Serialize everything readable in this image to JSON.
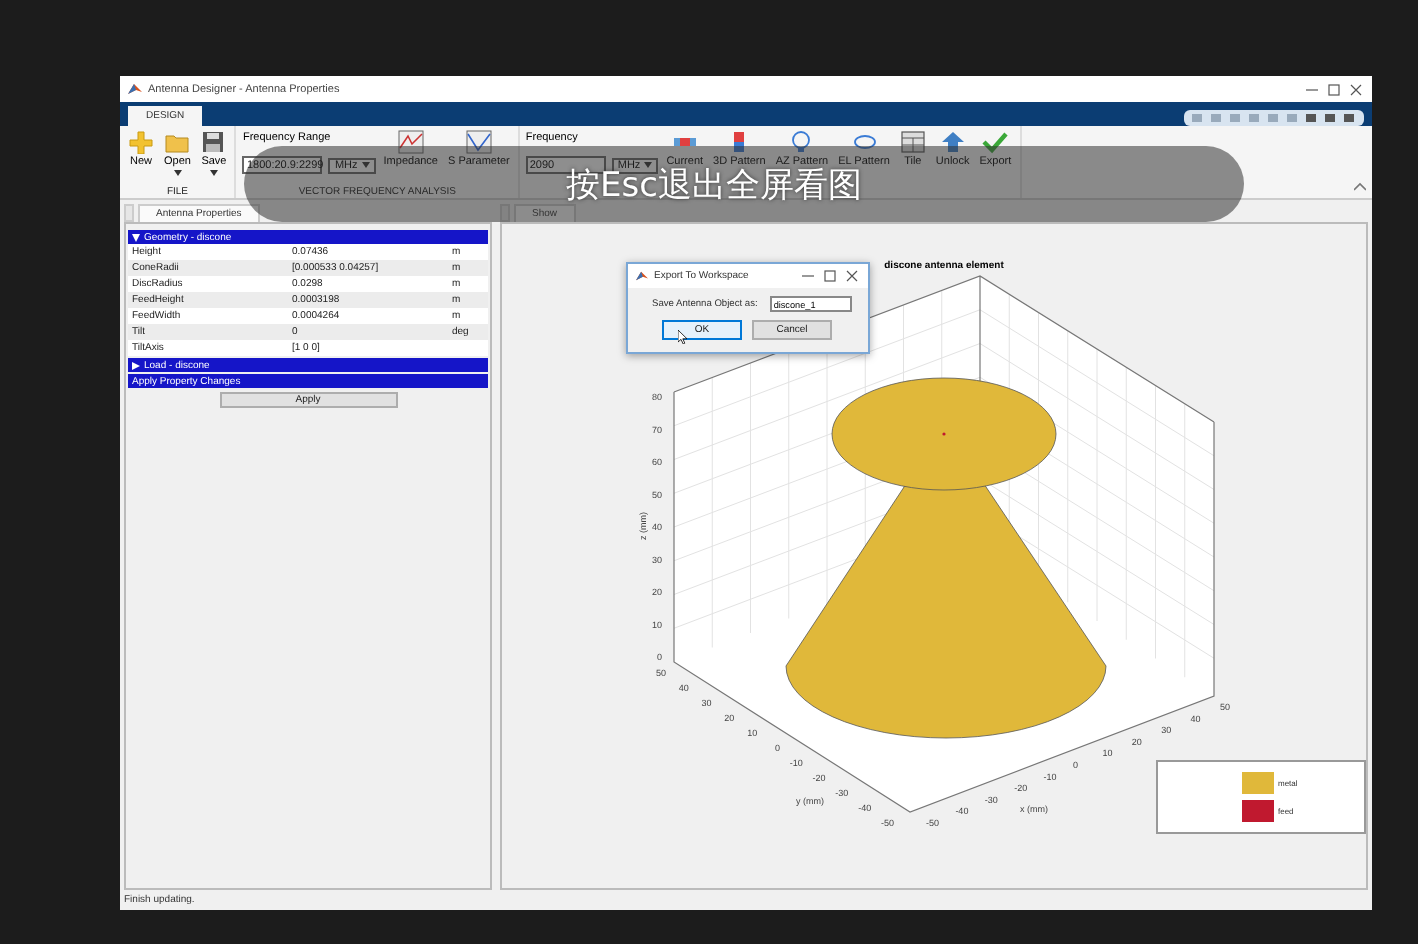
{
  "window": {
    "title": "Antenna Designer - Antenna Properties"
  },
  "ribbon": {
    "tabs": [
      {
        "label": "DESIGN",
        "selected": true
      }
    ],
    "groups": [
      {
        "label": "FILE",
        "buttons": [
          {
            "label": "New",
            "dropdown": false
          },
          {
            "label": "Open",
            "dropdown": true
          },
          {
            "label": "Save",
            "dropdown": true
          }
        ]
      },
      {
        "label": "VECTOR FREQUENCY ANALYSIS",
        "fields": [
          {
            "label": "Frequency Range",
            "value": "1800:20.9:2299",
            "unit": "MHz"
          }
        ],
        "buttons": [
          {
            "label": "Impedance",
            "dropdown": false
          },
          {
            "label": "S Parameter",
            "dropdown": false
          }
        ]
      },
      {
        "fields": [
          {
            "label": "Frequency",
            "value": "2090",
            "unit": "MHz"
          }
        ],
        "buttons": [
          {
            "label": "Current",
            "dropdown": false
          },
          {
            "label": "3D Pattern",
            "dropdown": false
          },
          {
            "label": "AZ Pattern",
            "dropdown": false
          },
          {
            "label": "EL Pattern",
            "dropdown": false
          },
          {
            "label": "Tile",
            "dropdown": false
          },
          {
            "label": "Unlock",
            "dropdown": false
          },
          {
            "label": "Export",
            "dropdown": false
          }
        ]
      }
    ]
  },
  "properties_panel": {
    "tab": "Antenna Properties",
    "sections": [
      {
        "title": "Geometry - discone",
        "expanded": true,
        "rows": [
          {
            "name": "Height",
            "value": "0.07436",
            "unit": "m"
          },
          {
            "name": "ConeRadii",
            "value": "[0.000533 0.04257]",
            "unit": "m"
          },
          {
            "name": "DiscRadius",
            "value": "0.0298",
            "unit": "m"
          },
          {
            "name": "FeedHeight",
            "value": "0.0003198",
            "unit": "m"
          },
          {
            "name": "FeedWidth",
            "value": "0.0004264",
            "unit": "m"
          },
          {
            "name": "Tilt",
            "value": "0",
            "unit": "deg"
          },
          {
            "name": "TiltAxis",
            "value": "[1 0 0]"
          }
        ]
      },
      {
        "title": "Load - discone",
        "expanded": false
      }
    ],
    "apply_header": "Apply Property Changes",
    "apply_button": "Apply"
  },
  "show_panel": {
    "tab": "Show"
  },
  "plot": {
    "title": "discone antenna element",
    "z_label": "z (mm)",
    "y_label": "y (mm)",
    "x_label": "x (mm)",
    "z_ticks": [
      "80",
      "70",
      "60",
      "50",
      "40",
      "30",
      "20",
      "10",
      "0"
    ],
    "y_ticks": [
      "50",
      "40",
      "30",
      "20",
      "10",
      "0",
      "-10",
      "-20",
      "-30",
      "-40",
      "-50"
    ],
    "x_ticks": [
      "-50",
      "-40",
      "-30",
      "-20",
      "-10",
      "0",
      "10",
      "20",
      "30",
      "40",
      "50"
    ],
    "legend": [
      {
        "label": "metal",
        "color": "#e0b83a"
      },
      {
        "label": "feed",
        "color": "#c0192f"
      }
    ]
  },
  "dialog": {
    "title": "Export To Workspace",
    "label": "Save Antenna Object as:",
    "value": "discone_1",
    "buttons": [
      {
        "label": "OK",
        "selected": true
      },
      {
        "label": "Cancel",
        "selected": false
      }
    ]
  },
  "status_bar": "Finish updating.",
  "overlay_hint": "按Esc退出全屏看图"
}
